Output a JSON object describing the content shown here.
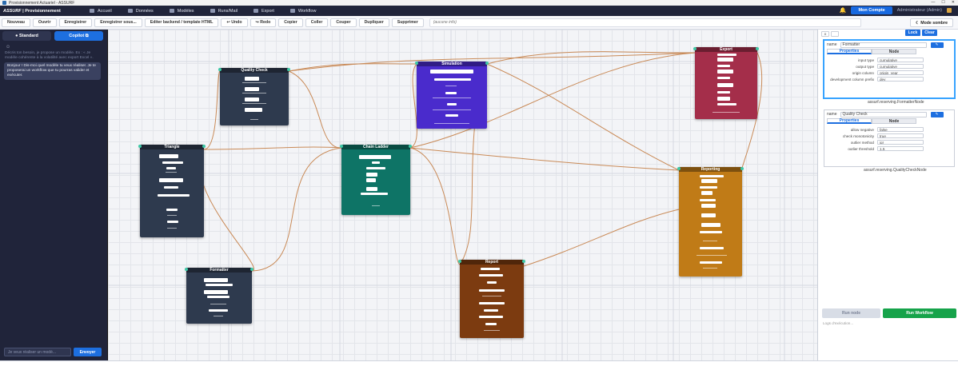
{
  "window": {
    "title": "Provisionnement Actuariel - ASSURF"
  },
  "topnav": {
    "brand": "ASSURF",
    "brand_section": "Provisionnement",
    "items": [
      "Accueil",
      "Données",
      "Modèles",
      "Runs/Mail",
      "Export",
      "Workflow"
    ],
    "account_button": "Mon Compte",
    "user_label": "Administrateur (Admin)"
  },
  "toolbar": {
    "buttons": [
      "Nouveau",
      "Ouvrir",
      "Enregistrer",
      "Enregistrer sous...",
      "Editer backend / template HTML",
      "↩ Undo",
      "↪ Redo",
      "Copier",
      "Coller",
      "Couper",
      "Dupliquer",
      "Supprimer"
    ],
    "field_placeholder": "(aucune info)",
    "dark_mode": "Mode sombre"
  },
  "sidebar": {
    "tab_standard": "Standard",
    "tab_copilot": "Copilot",
    "hint": "Décris ton besoin, je propose un modèle. Ex : « Je modèle cohérente à la volatilité avec export Excel ».",
    "bubble": "Bonjour ! Dis-moi quel modèle tu veux réaliser. Je te proposerai un workflow que tu pourras valider et exécuter.",
    "input_placeholder": "Je veux réaliser un modè...",
    "send_label": "Envoyer"
  },
  "nodes": {
    "quality": "Quality Check",
    "simulation": "Simulation",
    "export": "Export",
    "triangle": "Triangle",
    "chain_ladder": "Chain Ladder",
    "reporting": "Reporting",
    "formatter": "Formatter",
    "report": "Report"
  },
  "rpanel": {
    "lock": "Lock",
    "clear": "Clear",
    "card1": {
      "name_label": "name",
      "name_value": "Formatter",
      "tab_props": "Properties",
      "tab_node": "Node",
      "rows": [
        {
          "label": "input type",
          "value": "cumulative"
        },
        {
          "label": "output type",
          "value": "cumulative"
        },
        {
          "label": "origin column",
          "value": "origin_year"
        },
        {
          "label": "development column prefix",
          "value": "dev_"
        }
      ],
      "type": "assurf.reserving.FormatterNode"
    },
    "card2": {
      "name_label": "name",
      "name_value": "Quality Check",
      "tab_props": "Properties",
      "tab_node": "Node",
      "rows": [
        {
          "label": "allow negative",
          "value": "false"
        },
        {
          "label": "check monotonicity",
          "value": "true"
        },
        {
          "label": "outlier method",
          "value": "iqr"
        },
        {
          "label": "outlier threshold",
          "value": "1.5"
        }
      ],
      "type": "assurf.reserving.QualityCheckNode"
    },
    "run_node": "Run node",
    "run_workflow": "Run Workflow",
    "exec_log": "Logs d'exécution..."
  }
}
